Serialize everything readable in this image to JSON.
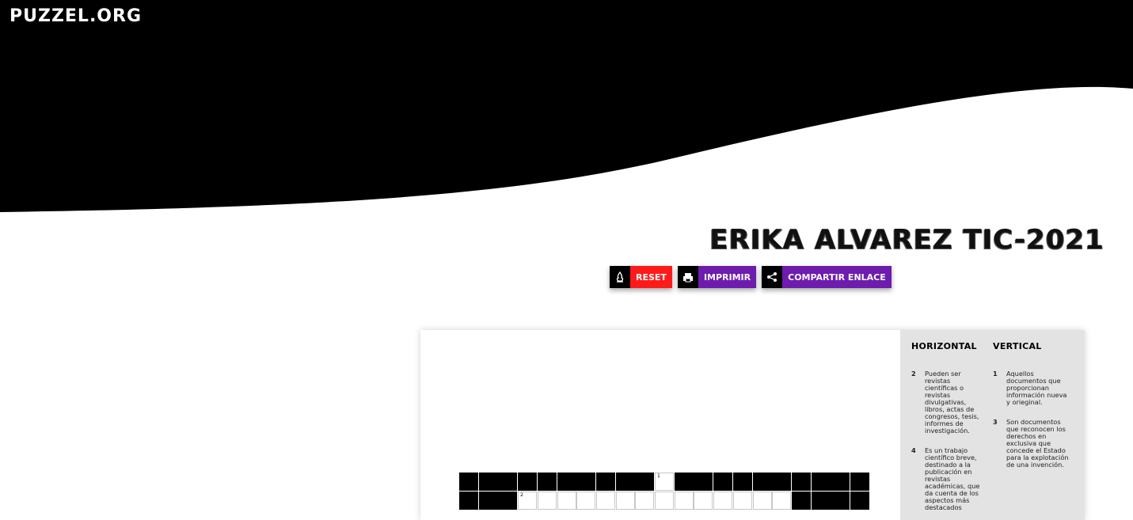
{
  "site": {
    "logo": "PUZZEL.ORG"
  },
  "puzzle": {
    "title": "ERIKA ALVAREZ TIC-2021"
  },
  "buttons": [
    {
      "label": "RESET",
      "icon": "reset-icon"
    },
    {
      "label": "IMPRIMIR",
      "icon": "print-icon"
    },
    {
      "label": "COMPARTIR ENLACE",
      "icon": "share-icon"
    }
  ],
  "clues": {
    "horizontal_title": "HORIZONTAL",
    "vertical_title": "VERTICAL",
    "horizontal": [
      {
        "num": "2",
        "text": "Pueden ser revistas científicas o revistas divulgativas, libros, actas de congresos, tesis, informes de investigación."
      },
      {
        "num": "4",
        "text": "Es un trabajo científico breve, destinado a la publicación en revistas académicas, que da cuenta de los aspectos más destacados"
      }
    ],
    "vertical": [
      {
        "num": "1",
        "text": "Aquellos documentos que proporcionan información nueva y orieginal."
      },
      {
        "num": "3",
        "text": "Son documentos que reconocen los derechos en exclusiva que concede el Estado para la explotación de una invención."
      }
    ]
  },
  "grid": {
    "cell_numbers": [
      "1",
      "2"
    ]
  },
  "colors": {
    "reset": "#ff1a1a",
    "purple": "#6d1cae",
    "clue_panel": "#e3e3e3"
  }
}
